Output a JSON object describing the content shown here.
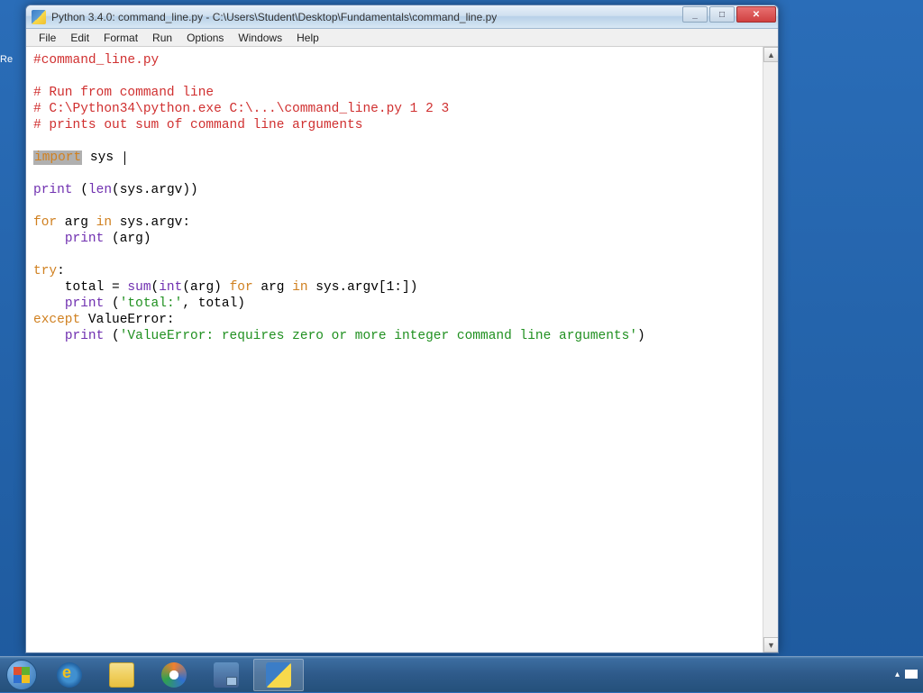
{
  "partial": {
    "text": "Re"
  },
  "window": {
    "title": "Python 3.4.0: command_line.py - C:\\Users\\Student\\Desktop\\Fundamentals\\command_line.py"
  },
  "menu": {
    "file": "File",
    "edit": "Edit",
    "format": "Format",
    "run": "Run",
    "options": "Options",
    "windows": "Windows",
    "help": "Help"
  },
  "code": {
    "l1": "#command_line.py",
    "l3": "# Run from command line",
    "l4": "# C:\\Python34\\python.exe C:\\...\\command_line.py 1 2 3",
    "l5": "# prints out sum of command line arguments",
    "l7_kw": "import",
    "l7_id": " sys",
    "l9_fn": "print",
    "l9_rest": " (",
    "l9_len": "len",
    "l9_rest2": "(sys.argv))",
    "l11_for": "for",
    "l11_mid": " arg ",
    "l11_in": "in",
    "l11_rest": " sys.argv:",
    "l12_indent": "    ",
    "l12_print": "print",
    "l12_rest": " (arg)",
    "l14_try": "try",
    "l14_colon": ":",
    "l15_indent": "    total = ",
    "l15_sum": "sum",
    "l15_op": "(",
    "l15_int": "int",
    "l15_mid": "(arg) ",
    "l15_for": "for",
    "l15_mid2": " arg ",
    "l15_in": "in",
    "l15_rest": " sys.argv[1:])",
    "l16_indent": "    ",
    "l16_print": "print",
    "l16_op": " (",
    "l16_str": "'total:'",
    "l16_rest": ", total)",
    "l17_except": "except",
    "l17_mid": " ValueError:",
    "l18_indent": "    ",
    "l18_print": "print",
    "l18_op": " (",
    "l18_str": "'ValueError: requires zero or more integer command line arguments'",
    "l18_close": ")"
  },
  "taskbar": {
    "items": [
      "start",
      "ie",
      "explorer",
      "media-player",
      "remote",
      "python-idle"
    ]
  }
}
